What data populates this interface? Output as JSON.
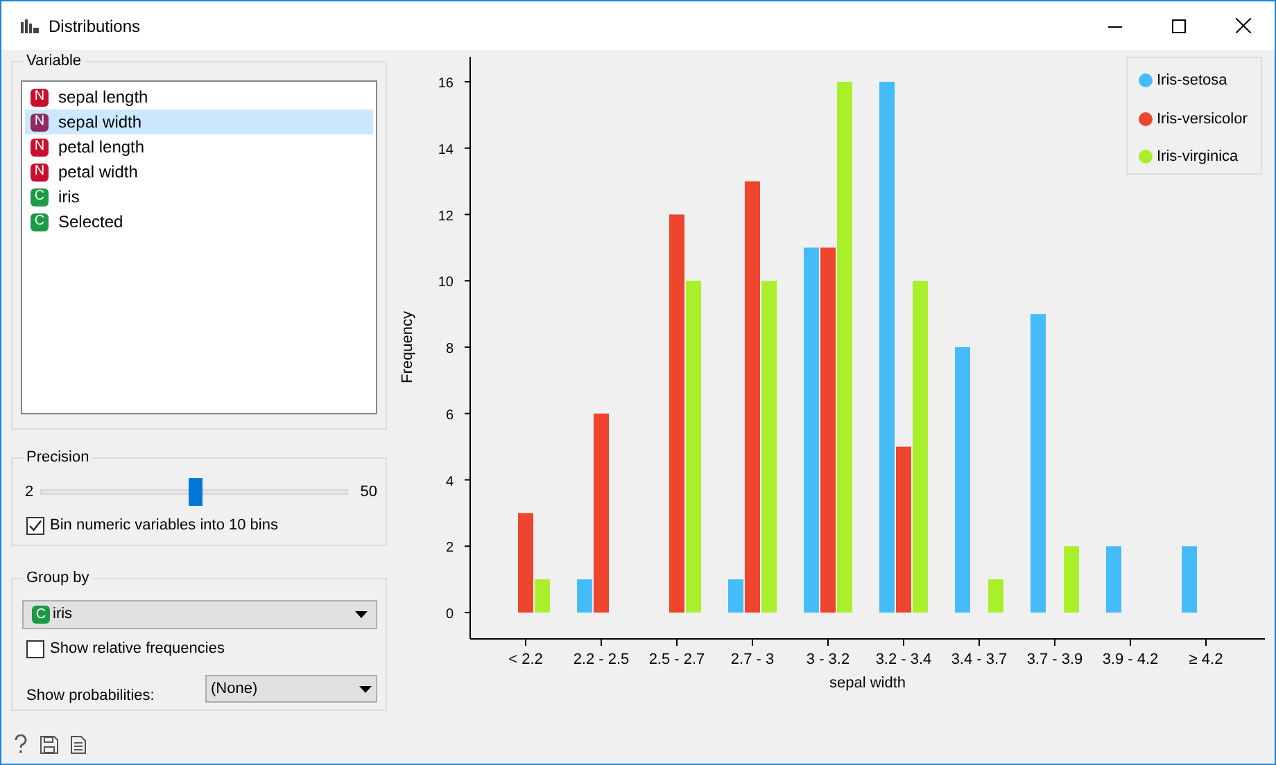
{
  "window": {
    "title": "Distributions"
  },
  "variable": {
    "title": "Variable",
    "items": [
      {
        "kind": "numeric",
        "badge": "N",
        "label": "sepal length",
        "selected": false
      },
      {
        "kind": "numeric",
        "badge": "N",
        "label": "sepal width",
        "selected": true
      },
      {
        "kind": "numeric",
        "badge": "N",
        "label": "petal length",
        "selected": false
      },
      {
        "kind": "numeric",
        "badge": "N",
        "label": "petal width",
        "selected": false
      },
      {
        "kind": "categorical",
        "badge": "C",
        "label": "iris",
        "selected": false
      },
      {
        "kind": "categorical",
        "badge": "C",
        "label": "Selected",
        "selected": false
      }
    ]
  },
  "precision": {
    "title": "Precision",
    "min_label": "2",
    "max_label": "50",
    "level": 0.5,
    "bin_checkbox": {
      "label": "Bin numeric variables into 10 bins",
      "checked": true
    }
  },
  "group_by": {
    "title": "Group by",
    "dropdown": {
      "kind": "categorical",
      "badge": "C",
      "value": "iris"
    },
    "relative_checkbox": {
      "label": "Show relative frequencies",
      "checked": false
    },
    "probabilities": {
      "label": "Show probabilities:",
      "value": "(None)"
    }
  },
  "chart_data": {
    "type": "bar",
    "xlabel": "sepal width",
    "ylabel": "Frequency",
    "categories": [
      "< 2.2",
      "2.2 - 2.5",
      "2.5 - 2.7",
      "2.7 - 3",
      "3 - 3.2",
      "3.2 - 3.4",
      "3.4 - 3.7",
      "3.7 - 3.9",
      "3.9 - 4.2",
      "≥ 4.2"
    ],
    "series": [
      {
        "name": "Iris-setosa",
        "color": "#45bcfa",
        "values": [
          0,
          1,
          0,
          1,
          11,
          16,
          8,
          9,
          2,
          2
        ]
      },
      {
        "name": "Iris-versicolor",
        "color": "#ee452e",
        "values": [
          3,
          6,
          12,
          13,
          11,
          5,
          0,
          0,
          0,
          0
        ]
      },
      {
        "name": "Iris-virginica",
        "color": "#a9ef2a",
        "values": [
          1,
          0,
          10,
          10,
          16,
          10,
          1,
          2,
          0,
          0
        ]
      }
    ],
    "legend": "upper right",
    "ylim": [
      0,
      16
    ],
    "yticks": [
      0,
      2,
      4,
      6,
      8,
      10,
      12,
      14,
      16
    ]
  }
}
